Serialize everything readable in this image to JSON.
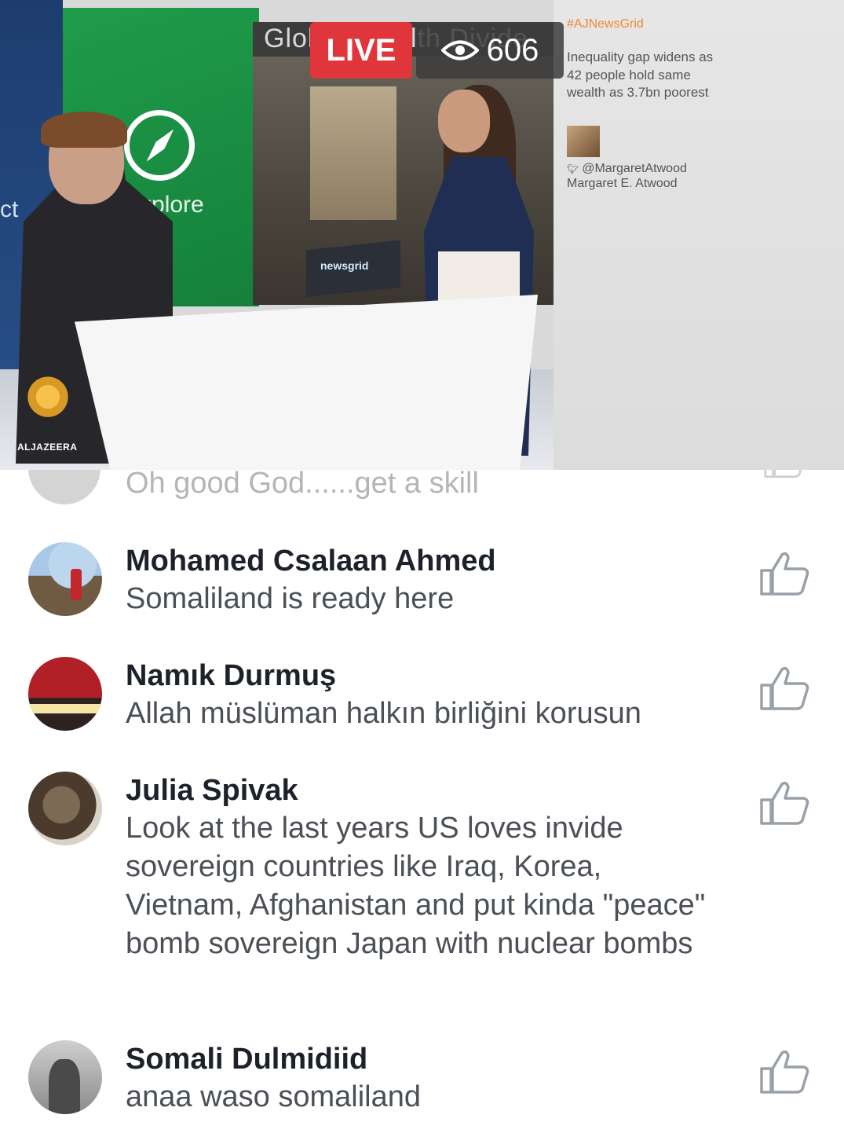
{
  "video": {
    "live_label": "LIVE",
    "viewer_count": "606",
    "screen_banner": "Global Wealth Divide",
    "explore_label": "Explore",
    "left_fragment": "ct",
    "desk_screen_text": "newsgrid",
    "logo_text": "ALJAZEERA",
    "side_panel": {
      "hashtag": "#AJNewsGrid",
      "headline": "Inequality gap widens as 42 people hold same wealth as 3.7bn poorest",
      "twitter_handle": "@MargaretAtwood",
      "author_name": "Margaret E. Atwood"
    }
  },
  "comments": {
    "partial": {
      "text": "Oh good God......get a skill"
    },
    "items": [
      {
        "author": "Mohamed Csalaan Ahmed",
        "text": "Somaliland  is ready here"
      },
      {
        "author": "Namık Durmuş",
        "text": "Allah müslüman halkın birliğini korusun"
      },
      {
        "author": "Julia Spivak",
        "text": "Look at the last years US loves invide sovereign countries like Iraq, Korea, Vietnam, Afghanistan and put kinda \"peace\" bomb sovereign Japan with nuclear bombs"
      },
      {
        "author": "Somali Dulmidiid",
        "text": "anaa waso somaliland"
      }
    ]
  }
}
